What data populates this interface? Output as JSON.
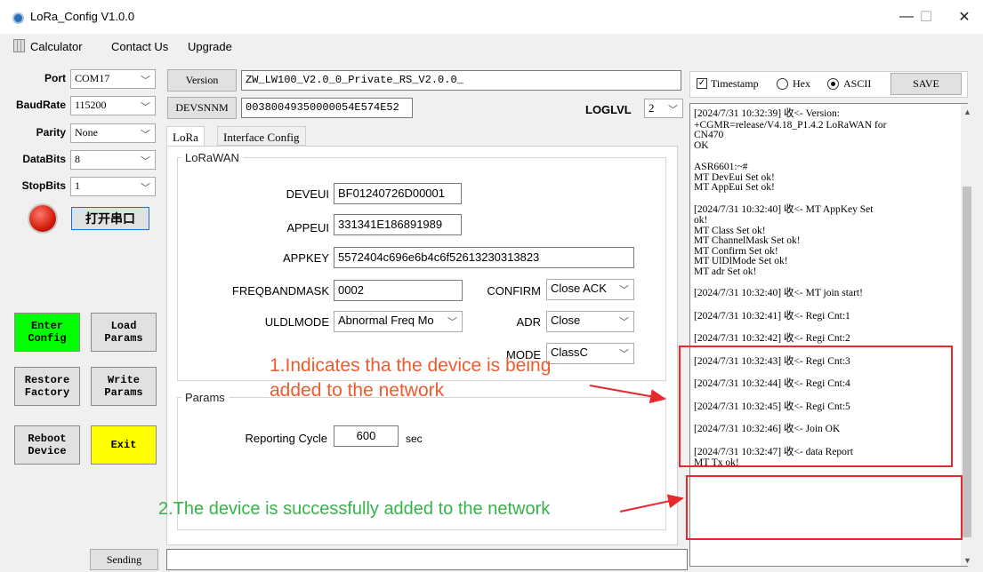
{
  "window": {
    "title": "LoRa_Config V1.0.0",
    "minimize_glyph": "—",
    "maximize_glyph": "☐",
    "close_glyph": "✕"
  },
  "menu": {
    "items": [
      "Calculator",
      "Contact Us",
      "Upgrade"
    ]
  },
  "serial": {
    "port_label": "Port",
    "port_value": "COM17",
    "baud_label": "BaudRate",
    "baud_value": "115200",
    "parity_label": "Parity",
    "parity_value": "None",
    "databits_label": "DataBits",
    "databits_value": "8",
    "stopbits_label": "StopBits",
    "stopbits_value": "1",
    "open_button": "打开串口",
    "led_color": "#d41c0c"
  },
  "actions": {
    "enter_config": [
      "Enter",
      "Config"
    ],
    "load_params": [
      "Load",
      "Params"
    ],
    "restore_factory": [
      "Restore",
      "Factory"
    ],
    "write_params": [
      "Write",
      "Params"
    ],
    "reboot_device": [
      "Reboot",
      "Device"
    ],
    "exit": "Exit",
    "enter_color": "#00ff00",
    "exit_color": "#ffff00"
  },
  "device": {
    "version_button": "Version",
    "version_value": "ZW_LW100_V2.0_0_Private_RS_V2.0.0_",
    "devsnnm_button": "DEVSNNM",
    "devsnnm_value": "00380049350000054E574E52",
    "loglvl_label": "LOGLVL",
    "loglvl_value": "2"
  },
  "tabs": [
    "LoRa",
    "Interface Config"
  ],
  "lorawan": {
    "group_title": "LoRaWAN",
    "deveui_label": "DEVEUI",
    "deveui_value": "BF01240726D00001",
    "appeui_label": "APPEUI",
    "appeui_value": "331341E186891989",
    "appkey_label": "APPKEY",
    "appkey_value": "5572404c696e6b4c6f52613230313823",
    "freqbandmask_label": "FREQBANDMASK",
    "freqbandmask_value": "0002",
    "confirm_label": "CONFIRM",
    "confirm_value": "Close ACK",
    "uldlmode_label": "ULDLMODE",
    "uldlmode_value": "Abnormal Freq Mo",
    "adr_label": "ADR",
    "adr_value": "Close",
    "mode_label": "MODE",
    "mode_value": "ClassC"
  },
  "params": {
    "group_title": "Params",
    "reporting_label": "Reporting Cycle",
    "reporting_value": "600",
    "reporting_unit": "sec"
  },
  "send": {
    "button": "Sending",
    "value": ""
  },
  "log_options": {
    "timestamp_label": "Timestamp",
    "timestamp_checked": true,
    "hex_label": "Hex",
    "ascii_label": "ASCII",
    "selected_format": "ASCII",
    "save_button": "SAVE"
  },
  "log_lines": [
    "[2024/7/31 10:32:39] 收<- Version:",
    "+CGMR=release/V4.18_P1.4.2 LoRaWAN for",
    "CN470",
    "OK",
    "",
    "ASR6601:~#",
    "MT DevEui Set ok!",
    "MT AppEui Set ok!",
    "",
    "[2024/7/31 10:32:40] 收<- MT AppKey Set",
    "ok!",
    "MT Class Set ok!",
    "MT ChannelMask Set ok!",
    "MT Confirm Set ok!",
    "MT UlDlMode Set ok!",
    "MT adr Set ok!",
    "",
    "[2024/7/31 10:32:40] 收<- MT join start!",
    "",
    "[2024/7/31 10:32:41] 收<- Regi Cnt:1",
    "",
    "[2024/7/31 10:32:42] 收<- Regi Cnt:2",
    "",
    "[2024/7/31 10:32:43] 收<- Regi Cnt:3",
    "",
    "[2024/7/31 10:32:44] 收<- Regi Cnt:4",
    "",
    "[2024/7/31 10:32:45] 收<- Regi Cnt:5",
    "",
    "[2024/7/31 10:32:46] 收<- Join OK",
    "",
    "[2024/7/31 10:32:47] 收<- data Report",
    "MT Tx ok!"
  ],
  "annotations": {
    "note1_line1": "1.Indicates tha the device is being",
    "note1_line2": "added to the network",
    "note2": "2.The device is successfully added to the network",
    "highlight_color": "#e8282d"
  }
}
